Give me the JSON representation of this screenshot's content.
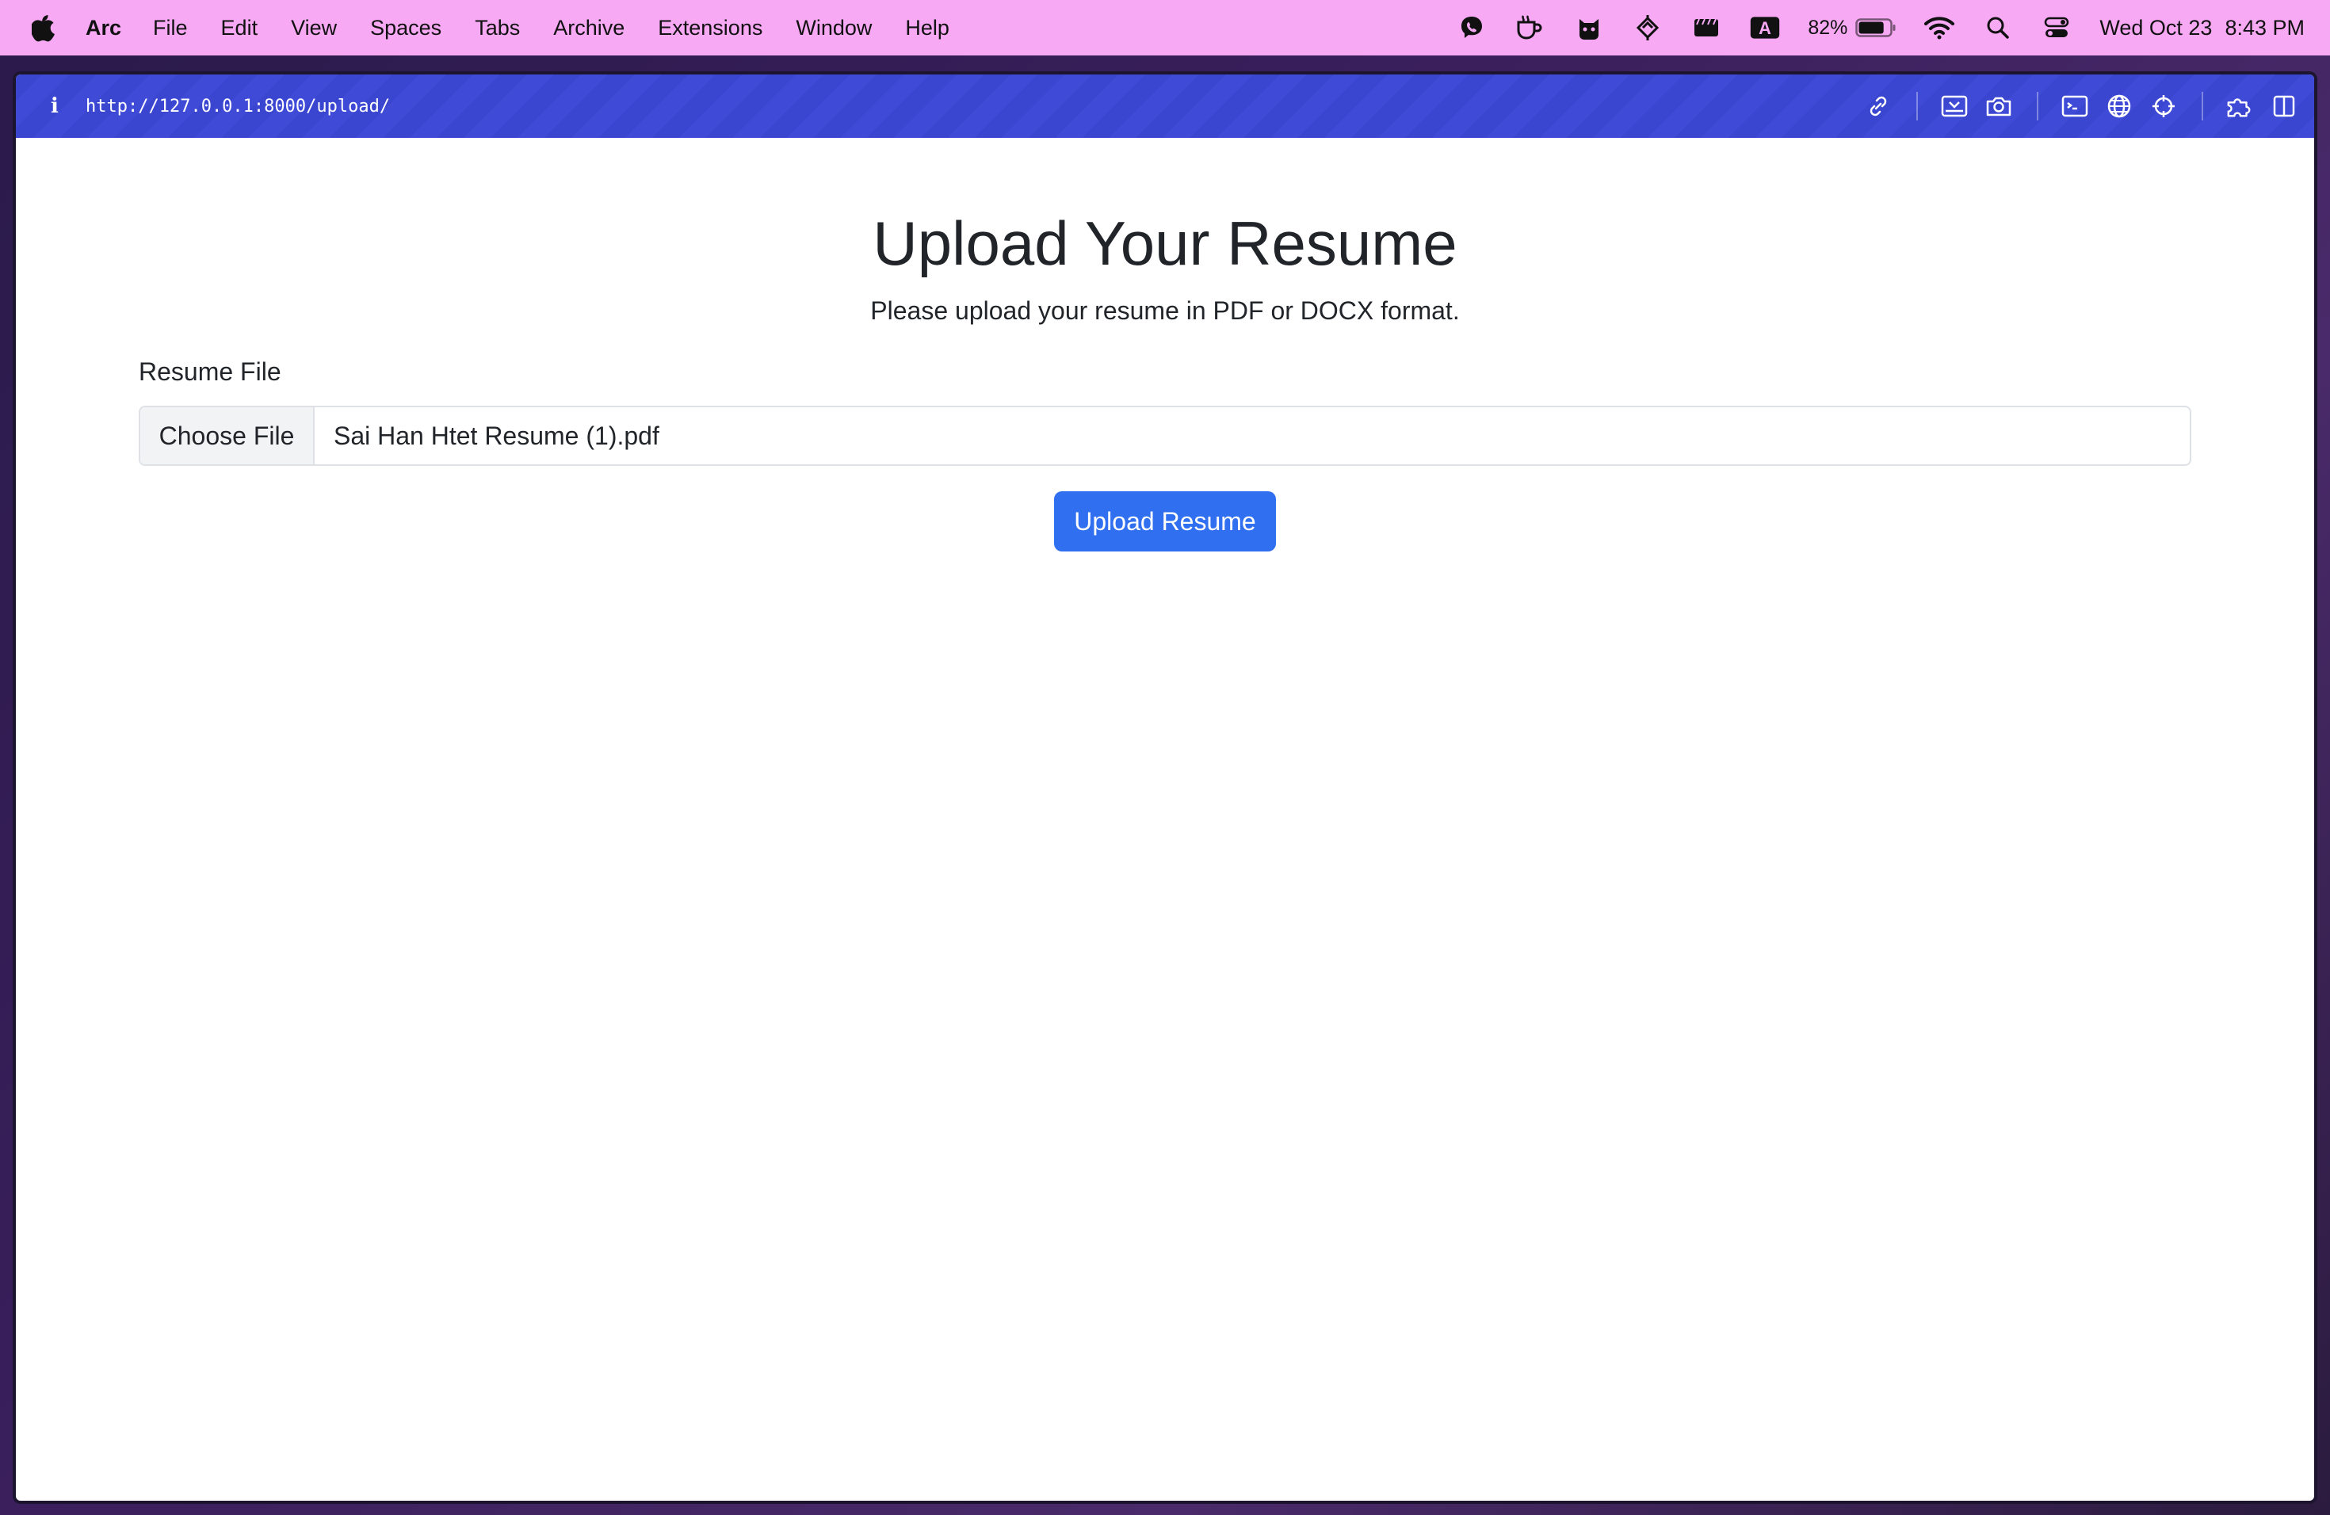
{
  "menubar": {
    "app_name": "Arc",
    "items": [
      "File",
      "Edit",
      "View",
      "Spaces",
      "Tabs",
      "Archive",
      "Extensions",
      "Window",
      "Help"
    ],
    "tray": {
      "input_source": "A",
      "battery_percent": "82%",
      "battery_level": 0.82,
      "date": "Wed Oct 23",
      "time": "8:43 PM"
    }
  },
  "browser": {
    "url": "http://127.0.0.1:8000/upload/",
    "accent_color": "#3a46d0"
  },
  "page": {
    "title": "Upload Your Resume",
    "subtitle": "Please upload your resume in PDF or DOCX format.",
    "field_label": "Resume File",
    "choose_file_label": "Choose File",
    "selected_file": "Sai Han Htet Resume (1).pdf",
    "submit_label": "Upload Resume",
    "button_color": "#2f6ff0"
  }
}
